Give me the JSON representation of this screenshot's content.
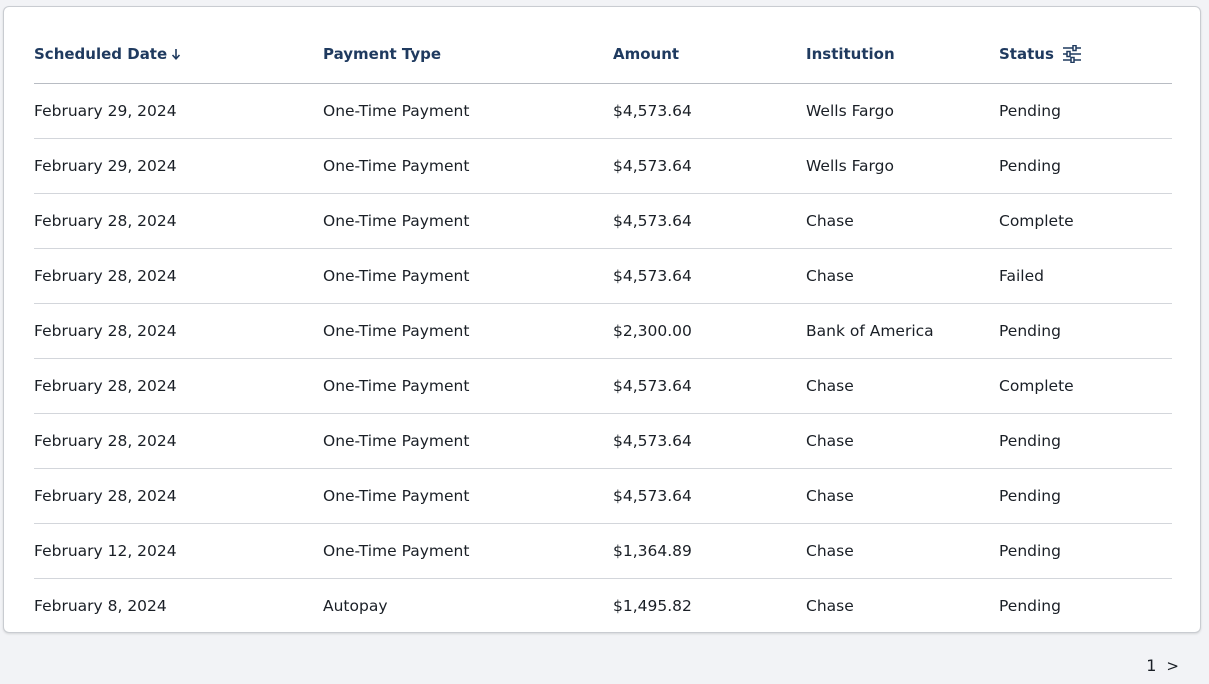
{
  "columns": {
    "scheduled_date": "Scheduled Date",
    "payment_type": "Payment Type",
    "amount": "Amount",
    "institution": "Institution",
    "status": "Status"
  },
  "sort": {
    "column": "scheduled_date",
    "direction": "descending",
    "icon": "arrow-down-icon"
  },
  "filter_icon": "sliders-icon",
  "rows": [
    {
      "date": "February 29, 2024",
      "type": "One-Time Payment",
      "amount": "$4,573.64",
      "institution": "Wells Fargo",
      "status": "Pending"
    },
    {
      "date": "February 29, 2024",
      "type": "One-Time Payment",
      "amount": "$4,573.64",
      "institution": "Wells Fargo",
      "status": "Pending"
    },
    {
      "date": "February 28, 2024",
      "type": "One-Time Payment",
      "amount": "$4,573.64",
      "institution": "Chase",
      "status": "Complete"
    },
    {
      "date": "February 28, 2024",
      "type": "One-Time Payment",
      "amount": "$4,573.64",
      "institution": "Chase",
      "status": "Failed"
    },
    {
      "date": "February 28, 2024",
      "type": "One-Time Payment",
      "amount": "$2,300.00",
      "institution": "Bank of America",
      "status": "Pending"
    },
    {
      "date": "February 28, 2024",
      "type": "One-Time Payment",
      "amount": "$4,573.64",
      "institution": "Chase",
      "status": "Complete"
    },
    {
      "date": "February 28, 2024",
      "type": "One-Time Payment",
      "amount": "$4,573.64",
      "institution": "Chase",
      "status": "Pending"
    },
    {
      "date": "February 28, 2024",
      "type": "One-Time Payment",
      "amount": "$4,573.64",
      "institution": "Chase",
      "status": "Pending"
    },
    {
      "date": "February 12, 2024",
      "type": "One-Time Payment",
      "amount": "$1,364.89",
      "institution": "Chase",
      "status": "Pending"
    },
    {
      "date": "February 8, 2024",
      "type": "Autopay",
      "amount": "$1,495.82",
      "institution": "Chase",
      "status": "Pending"
    }
  ],
  "pagination": {
    "current_page": "1",
    "next_label": ">"
  },
  "colors": {
    "header_text": "#1f3a5f",
    "body_text": "#1a1f26",
    "background": "#f2f3f6",
    "card": "#ffffff"
  }
}
